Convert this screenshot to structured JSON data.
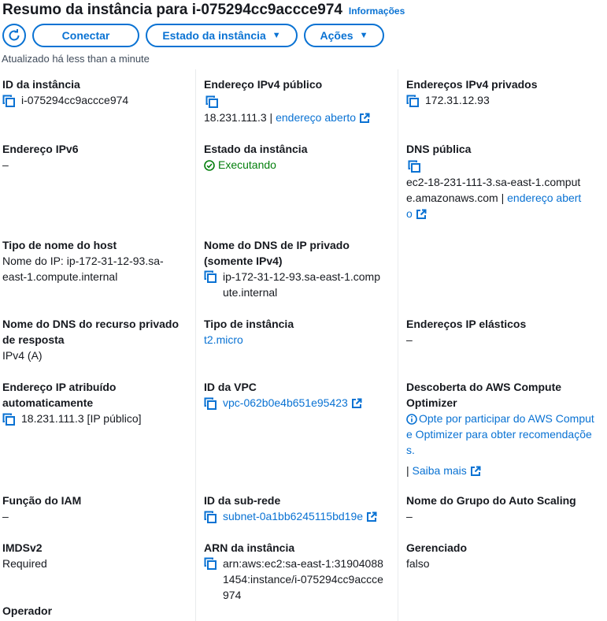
{
  "header": {
    "title": "Resumo da instância para i-075294cc9accce974",
    "info_link": "Informações"
  },
  "toolbar": {
    "refresh_icon": "refresh-icon",
    "connect_label": "Conectar",
    "state_label": "Estado da instância",
    "actions_label": "Ações"
  },
  "updated_text": "Atualizado há less than a minute",
  "fields": {
    "instance_id": {
      "label": "ID da instância",
      "value": "i-075294cc9accce974"
    },
    "public_ipv4": {
      "label": "Endereço IPv4 público",
      "value": "18.231.111.3 |",
      "link": "endereço aberto"
    },
    "private_ipv4": {
      "label": "Endereços IPv4 privados",
      "value": "172.31.12.93"
    },
    "ipv6": {
      "label": "Endereço IPv6",
      "value": "–"
    },
    "instance_state": {
      "label": "Estado da instância",
      "value": "Executando"
    },
    "public_dns": {
      "label": "DNS pública",
      "value": "ec2-18-231-111-3.sa-east-1.compute.amazonaws.com |",
      "link": "endereço aberto"
    },
    "hostname_type": {
      "label": "Tipo de nome do host",
      "value": "Nome do IP: ip-172-31-12-93.sa-east-1.compute.internal"
    },
    "private_dns": {
      "label": "Nome do DNS de IP privado (somente IPv4)",
      "value": "ip-172-31-12-93.sa-east-1.compute.internal"
    },
    "resource_dns": {
      "label": "Nome do DNS do recurso privado de resposta",
      "value": "IPv4 (A)"
    },
    "instance_type": {
      "label": "Tipo de instância",
      "value": "t2.micro"
    },
    "elastic_ip": {
      "label": "Endereços IP elásticos",
      "value": "–"
    },
    "auto_ip": {
      "label": "Endereço IP atribuído automaticamente",
      "value": "18.231.111.3 [IP público]"
    },
    "vpc_id": {
      "label": "ID da VPC",
      "value": "vpc-062b0e4b651e95423"
    },
    "compute_optimizer": {
      "label": "Descoberta do AWS Compute Optimizer",
      "value": "Opte por participar do AWS Compute Optimizer para obter recomendações.",
      "learn_more": "Saiba mais"
    },
    "iam_role": {
      "label": "Função do IAM",
      "value": "–"
    },
    "subnet_id": {
      "label": "ID da sub-rede",
      "value": "subnet-0a1bb6245115bd19e"
    },
    "asg_name": {
      "label": "Nome do Grupo do Auto Scaling",
      "value": "–"
    },
    "imdsv2": {
      "label": "IMDSv2",
      "value": "Required"
    },
    "instance_arn": {
      "label": "ARN da instância",
      "value": "arn:aws:ec2:sa-east-1:319040881454:instance/i-075294cc9accce974"
    },
    "managed": {
      "label": "Gerenciado",
      "value": "falso"
    },
    "operator": {
      "label": "Operador"
    }
  },
  "colors": {
    "link": "#0972d3",
    "success": "#037f0c",
    "divider": "#e9ebed",
    "text": "#16191f"
  }
}
